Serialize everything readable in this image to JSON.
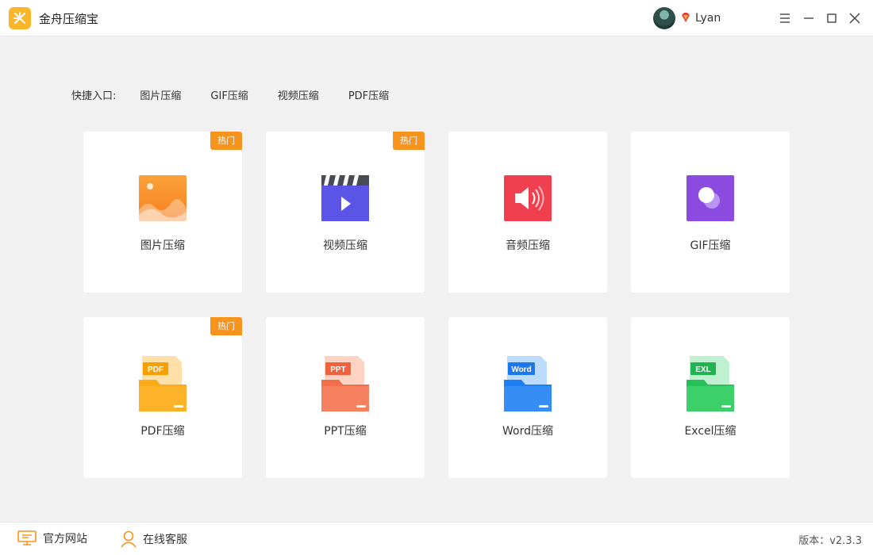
{
  "app": {
    "title": "金舟压缩宝",
    "username": "Lyan",
    "version": "版本：v2.3.3"
  },
  "colors": {
    "brand": "#fbb52a",
    "hot_badge": "#f7941d"
  },
  "quick": {
    "label": "快捷入口:",
    "links": [
      "图片压缩",
      "GIF压缩",
      "视频压缩",
      "PDF压缩"
    ]
  },
  "cards": [
    {
      "label": "图片压缩",
      "hot": "热门",
      "icon": "image-icon"
    },
    {
      "label": "视频压缩",
      "hot": "热门",
      "icon": "video-icon"
    },
    {
      "label": "音频压缩",
      "hot": "",
      "icon": "audio-icon"
    },
    {
      "label": "GIF压缩",
      "hot": "",
      "icon": "gif-icon"
    },
    {
      "label": "PDF压缩",
      "hot": "热门",
      "icon": "pdf-file-icon",
      "tag": "PDF"
    },
    {
      "label": "PPT压缩",
      "hot": "",
      "icon": "ppt-file-icon",
      "tag": "PPT"
    },
    {
      "label": "Word压缩",
      "hot": "",
      "icon": "word-file-icon",
      "tag": "Word"
    },
    {
      "label": "Excel压缩",
      "hot": "",
      "icon": "excel-file-icon",
      "tag": "EXL"
    }
  ],
  "bottom": {
    "website": "官方网站",
    "support": "在线客服"
  }
}
